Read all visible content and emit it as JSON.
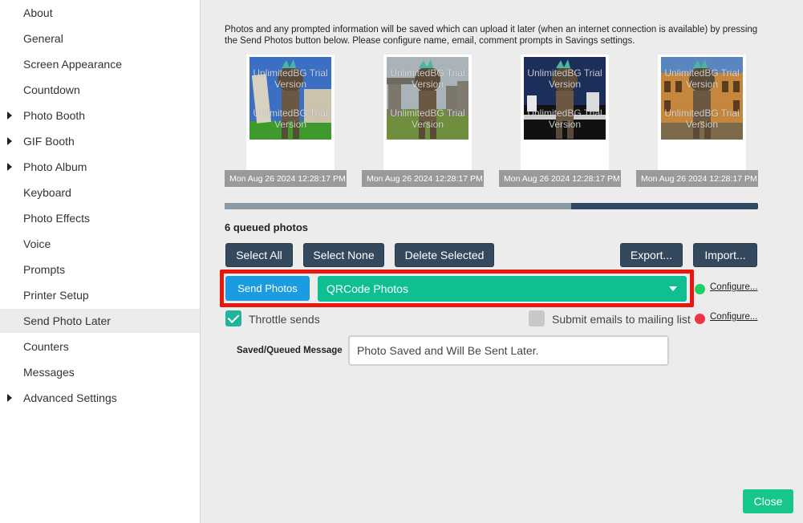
{
  "sidebar": {
    "items": [
      {
        "label": "About",
        "arrow": false
      },
      {
        "label": "General",
        "arrow": false
      },
      {
        "label": "Screen Appearance",
        "arrow": false
      },
      {
        "label": "Countdown",
        "arrow": false
      },
      {
        "label": "Photo Booth",
        "arrow": true
      },
      {
        "label": "GIF Booth",
        "arrow": true
      },
      {
        "label": "Photo Album",
        "arrow": true
      },
      {
        "label": "Keyboard",
        "arrow": false
      },
      {
        "label": "Photo Effects",
        "arrow": false
      },
      {
        "label": "Voice",
        "arrow": false
      },
      {
        "label": "Prompts",
        "arrow": false
      },
      {
        "label": "Printer Setup",
        "arrow": false
      },
      {
        "label": "Send Photo Later",
        "arrow": false,
        "active": true
      },
      {
        "label": "Counters",
        "arrow": false
      },
      {
        "label": "Messages",
        "arrow": false
      },
      {
        "label": "Advanced Settings",
        "arrow": true
      }
    ]
  },
  "main": {
    "info_text": "Photos and any prompted information will be saved which can upload it later (when an internet connection is available) by pressing the Send Photos button below. Please configure name, email, comment prompts in Savings settings.",
    "thumbnails": [
      {
        "watermark_top": "UnlimitedBG Trial Version",
        "watermark_bottom": "UnlimitedBG Trial Version",
        "timestamp": "Mon Aug 26 2024 12:28:17 PM",
        "scene": "pisa"
      },
      {
        "watermark_top": "UnlimitedBG Trial Version",
        "watermark_bottom": "UnlimitedBG Trial Version",
        "timestamp": "Mon Aug 26 2024 12:28:17 PM",
        "scene": "stonehenge"
      },
      {
        "watermark_top": "UnlimitedBG Trial Version",
        "watermark_bottom": "UnlimitedBG Trial Version",
        "timestamp": "Mon Aug 26 2024 12:28:17 PM",
        "scene": "city"
      },
      {
        "watermark_top": "UnlimitedBG Trial Version",
        "watermark_bottom": "UnlimitedBG Trial Version",
        "timestamp": "Mon Aug 26 2024 12:28:17 PM",
        "scene": "colosseum"
      }
    ],
    "progress": 0.65,
    "queued_label": "6 queued photos",
    "buttons": {
      "select_all": "Select All",
      "select_none": "Select None",
      "delete_selected": "Delete Selected",
      "export": "Export...",
      "import": "Import...",
      "send_photos": "Send Photos",
      "close": "Close"
    },
    "destination": {
      "selected": "QRCode Photos",
      "status_color": "#22cc66",
      "configure_label": "Configure..."
    },
    "throttle": {
      "label": "Throttle sends",
      "checked": true
    },
    "mailing": {
      "label": "Submit emails to mailing list",
      "checked": false,
      "status_color": "#ee3344",
      "configure_label": "Configure..."
    },
    "saved_message": {
      "label": "Saved/Queued Message",
      "value": "Photo Saved and Will Be Sent Later."
    }
  },
  "colors": {
    "accent_dark": "#34495e",
    "send_blue": "#1b9be0",
    "select_green": "#0fbf91",
    "highlight_red": "#e8160c"
  }
}
